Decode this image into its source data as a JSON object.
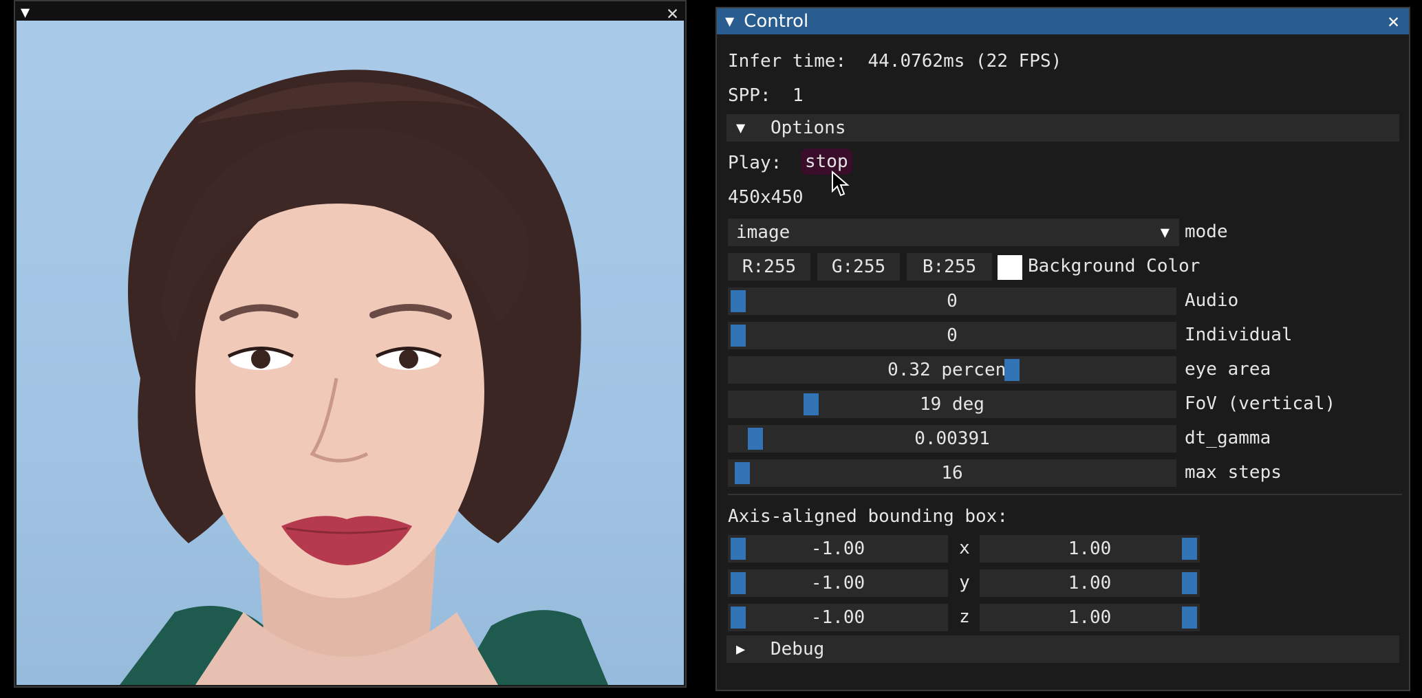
{
  "viewer": {
    "expand_icon": "triangle-down-icon",
    "close_icon": "close-icon"
  },
  "control": {
    "title": "Control",
    "close_icon": "close-icon",
    "infer_label": "Infer time:",
    "infer_value": "44.0762ms (22 FPS)",
    "spp_label": "SPP:",
    "spp_value": "1",
    "options_label": "Options",
    "play_label": "Play:",
    "play_button": "stop",
    "resolution": "450x450",
    "mode_value": "image",
    "mode_label": "mode",
    "color": {
      "r": "R:255",
      "g": "G:255",
      "b": "B:255",
      "label": "Background Color",
      "swatch": "#ffffff"
    },
    "sliders": [
      {
        "label": "Audio",
        "value": "0",
        "fraction": 0.0
      },
      {
        "label": "Individual",
        "value": "0",
        "fraction": 0.0
      },
      {
        "label": "eye area",
        "value": "0.32 percent",
        "fraction": 0.64
      },
      {
        "label": "FoV (vertical)",
        "value": "19 deg",
        "fraction": 0.17
      },
      {
        "label": "dt_gamma",
        "value": "0.00391",
        "fraction": 0.04
      },
      {
        "label": "max steps",
        "value": "16",
        "fraction": 0.01
      }
    ],
    "aabb_label": "Axis-aligned bounding box:",
    "aabb": [
      {
        "axis": "x",
        "min": "-1.00",
        "max": "1.00"
      },
      {
        "axis": "y",
        "min": "-1.00",
        "max": "1.00"
      },
      {
        "axis": "z",
        "min": "-1.00",
        "max": "1.00"
      }
    ],
    "debug_label": "Debug"
  },
  "colors": {
    "title_bar": "#2a5d8f",
    "grab": "#3273b6",
    "stop_button_bg": "#3a0d2a"
  }
}
